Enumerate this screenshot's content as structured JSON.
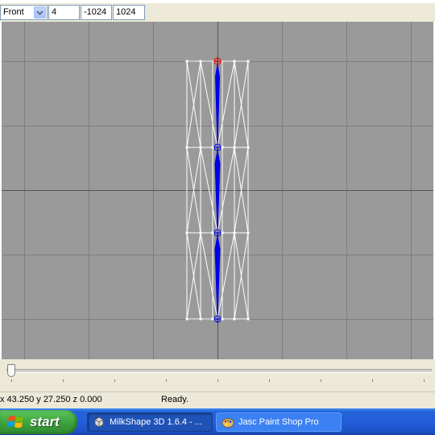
{
  "toolbar": {
    "view_select": "Front",
    "grid_size": "4",
    "min_value": "-1024",
    "max_value": "1024"
  },
  "status": {
    "coordinates": "x 43.250 y 27.250 z 0.000",
    "message": "Ready."
  },
  "taskbar": {
    "start_label": "start",
    "tasks": [
      {
        "label": "MilkShape 3D 1.6.4 - ...",
        "active": true,
        "icon": "milkshape-icon"
      },
      {
        "label": "Jasc Paint Shop Pro",
        "active": false,
        "icon": "paint-shop-pro-icon"
      }
    ]
  },
  "colors": {
    "viewport_bg": "#9a9a9a",
    "grid_line": "#7e7e7e",
    "axis_line": "#555555",
    "mesh": "#ffffff",
    "bone": "#0000e6",
    "root_joint": "#e60000",
    "taskbar": "#245edb",
    "start_button": "#3a9d3a"
  },
  "timeline": {
    "position": 0.0
  }
}
